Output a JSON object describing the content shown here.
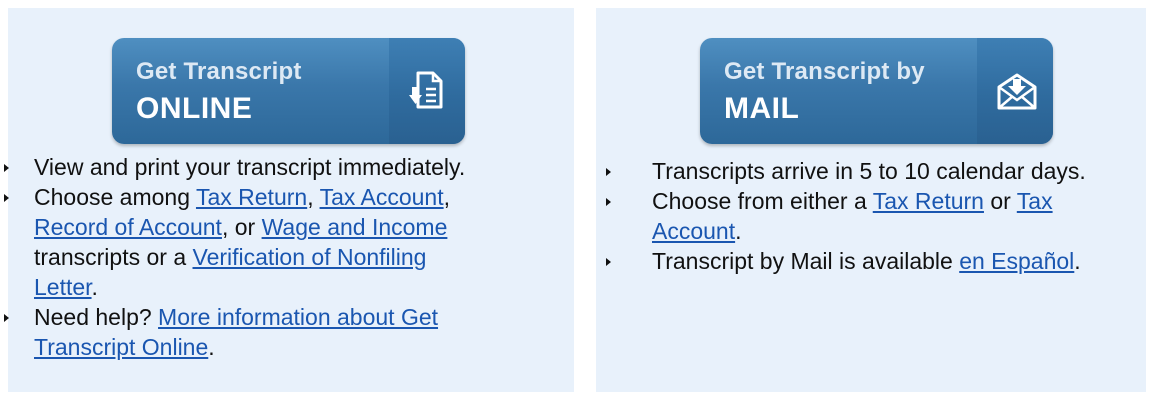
{
  "online": {
    "button": {
      "line1": "Get Transcript",
      "line2": "ONLINE",
      "icon": "document-download-icon"
    },
    "items": [
      {
        "text": "View and print your transcript immediately."
      },
      {
        "t1": "Choose among ",
        "l1": "Tax Return",
        "t2": ", ",
        "l2": "Tax Account",
        "t3": ", ",
        "l3": "Record of Account",
        "t4": ", or ",
        "l4": "Wage and Income",
        "t5": " transcripts or a ",
        "l5": "Verification of Nonfiling Letter",
        "t6": "."
      },
      {
        "t1": "Need help? ",
        "l1": "More information about Get Transcript Online",
        "t2": "."
      }
    ]
  },
  "mail": {
    "button": {
      "line1": "Get Transcript by",
      "line2": "MAIL",
      "icon": "envelope-download-icon"
    },
    "items": [
      {
        "text": "Transcripts arrive in 5 to 10 calendar days."
      },
      {
        "t1": "Choose from either a ",
        "l1": "Tax Return",
        "t2": " or ",
        "l2": "Tax Account",
        "t3": "."
      },
      {
        "t1": "Transcript by Mail is available ",
        "l1": "en Español",
        "t2": "."
      }
    ]
  }
}
